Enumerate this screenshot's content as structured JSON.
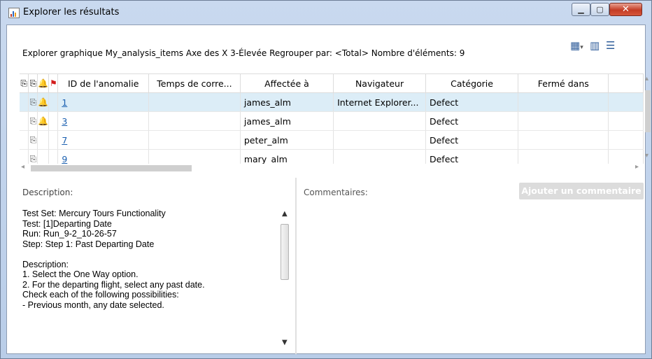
{
  "window": {
    "title": "Explorer les résultats"
  },
  "info_bar": {
    "text": "Explorer graphique My_analysis_items Axe des X 3-Élevée Regrouper par: <Total> Nombre d'éléments: 9"
  },
  "toolbar_icons": [
    "grid-select-icon",
    "column-chooser-icon",
    "export-icon"
  ],
  "grid": {
    "columns": [
      "ID de l'anomalie",
      "Temps de corre...",
      "Affectée à",
      "Navigateur",
      "Catégorie",
      "Fermé dans"
    ],
    "rows": [
      {
        "id": "1",
        "temps": "",
        "assigned": "james_alm",
        "browser": "Internet Explorer...",
        "category": "Defect",
        "closed": "",
        "attach": true,
        "alert": true,
        "selected": true
      },
      {
        "id": "3",
        "temps": "",
        "assigned": "james_alm",
        "browser": "",
        "category": "Defect",
        "closed": "",
        "attach": true,
        "alert": true,
        "selected": false
      },
      {
        "id": "7",
        "temps": "",
        "assigned": "peter_alm",
        "browser": "",
        "category": "Defect",
        "closed": "",
        "attach": true,
        "alert": false,
        "selected": false
      },
      {
        "id": "9",
        "temps": "",
        "assigned": "mary_alm",
        "browser": "",
        "category": "Defect",
        "closed": "",
        "attach": true,
        "alert": false,
        "selected": false
      }
    ]
  },
  "description": {
    "label": "Description:",
    "lines": [
      "Test Set: Mercury Tours Functionality",
      "Test: [1]Departing Date",
      "Run: Run_9-2_10-26-57",
      "Step: Step 1: Past Departing Date",
      "",
      "Description:",
      "1. Select the One Way option.",
      "2. For the departing flight, select any past date.",
      "Check each of the following possibilities:",
      "- Previous month, any date selected."
    ]
  },
  "comments": {
    "label": "Commentaires:",
    "add_button": "Ajouter un commentaire"
  },
  "colors": {
    "accent_link": "#1a5fb0",
    "selected_row": "#dcedf7",
    "alert": "#d31c1c"
  }
}
